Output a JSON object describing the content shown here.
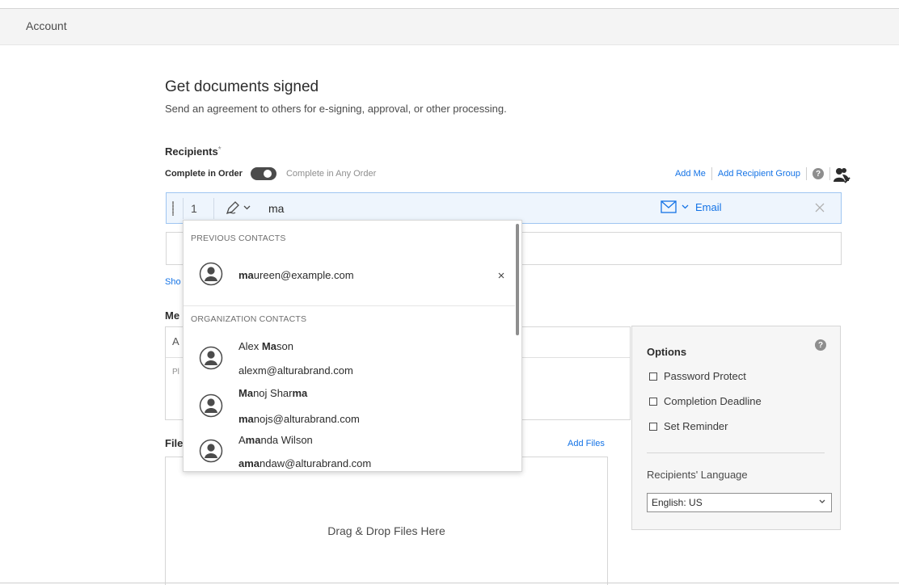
{
  "header": {
    "account": "Account"
  },
  "page": {
    "title": "Get documents signed",
    "subtitle": "Send an agreement to others for e-signing, approval, or other processing."
  },
  "recipients": {
    "label": "Recipients",
    "required_mark": "*",
    "complete_in_order": "Complete in Order",
    "complete_any_order": "Complete in Any Order",
    "add_me": "Add Me",
    "add_group": "Add Recipient Group",
    "help": "?",
    "row1": {
      "number": "1",
      "typed": "ma",
      "auth": "Email"
    },
    "show_link": "Sho"
  },
  "message": {
    "label": "Me",
    "name_prefix": "A",
    "msg_prefix": "Pl"
  },
  "files": {
    "label": "File",
    "add_files": "Add Files",
    "drop_text": "Drag & Drop Files Here"
  },
  "options": {
    "title": "Options",
    "help": "?",
    "items": [
      "Password Protect",
      "Completion Deadline",
      "Set Reminder"
    ],
    "language_label": "Recipients' Language",
    "language_value": "English: US"
  },
  "dropdown": {
    "previous_header": "PREVIOUS CONTACTS",
    "previous": [
      {
        "email_match": "ma",
        "email_rest": "ureen@example.com",
        "remove": "×"
      }
    ],
    "org_header": "ORGANIZATION CONTACTS",
    "org": [
      {
        "name_a": "Alex ",
        "name_b": "Ma",
        "name_c": "son",
        "name_d": "",
        "name_e": "",
        "email_a": "",
        "email_b": "",
        "email_c": "alexm@alturabrand.com"
      },
      {
        "name_a": "",
        "name_b": "Ma",
        "name_c": "noj Shar",
        "name_d": "ma",
        "name_e": "",
        "email_a": "",
        "email_b": "ma",
        "email_c": "nojs@alturabrand.com"
      },
      {
        "name_a": "A",
        "name_b": "ma",
        "name_c": "nda Wilson",
        "name_d": "",
        "name_e": "",
        "email_a": "",
        "email_b": "ama",
        "email_c": "ndaw@alturabrand.com"
      }
    ]
  },
  "colors": {
    "link": "#1473e6",
    "focus_border": "#9ec5f1",
    "focus_bg": "#eef5fd"
  }
}
